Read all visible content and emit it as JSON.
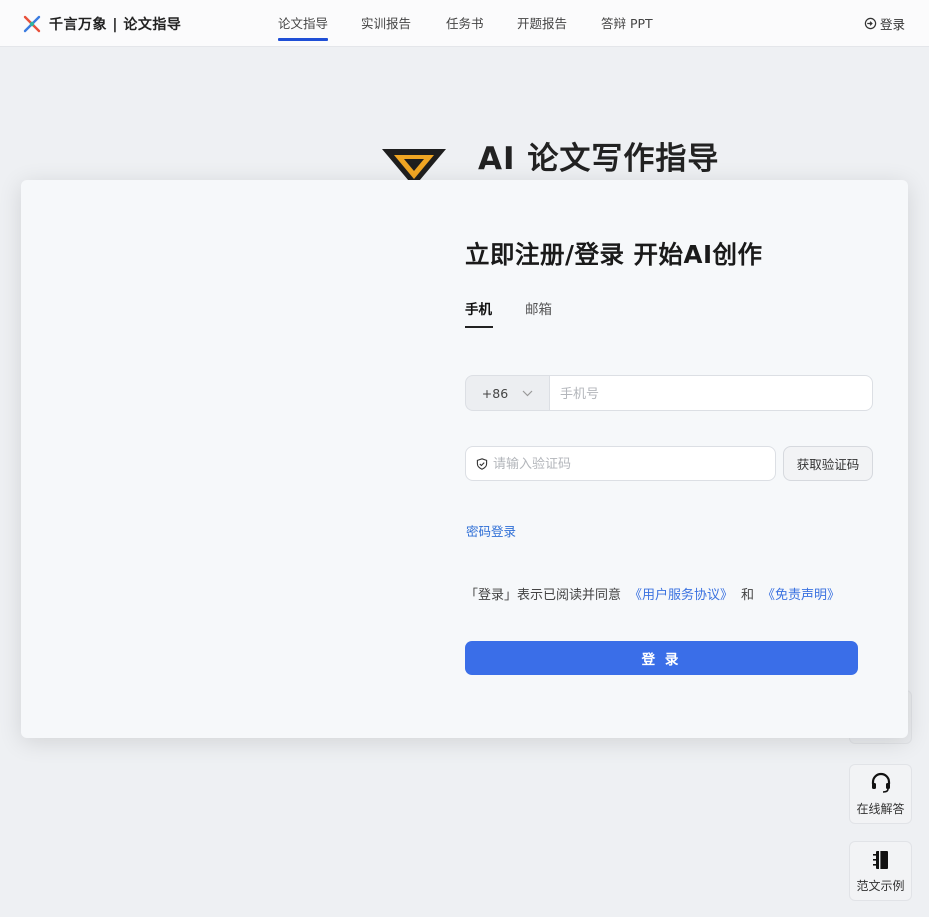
{
  "nav": {
    "brand": "千言万象 | 论文指导",
    "items": [
      "论文指导",
      "实训报告",
      "任务书",
      "开题报告",
      "答辩 PPT"
    ],
    "active_index": 0,
    "login": "登录"
  },
  "hero": {
    "title": "AI 论文写作指导"
  },
  "modal": {
    "title": "立即注册/登录 开始AI创作",
    "tabs": [
      "手机",
      "邮箱"
    ],
    "active_tab": "手机",
    "country_code": "+86",
    "phone_placeholder": "手机号",
    "code_placeholder": "请输入验证码",
    "get_code_label": "获取验证码",
    "password_login_label": "密码登录",
    "agree_prefix": "「登录」表示已阅读并同意",
    "terms_link": "《用户服务协议》",
    "agree_and": "和",
    "disclaimer_link": "《免责声明》",
    "login_button": "登 录"
  },
  "side": {
    "support_label": "在线解答",
    "samples_label": "范文示例"
  },
  "colors": {
    "accent": "#3a6ee8",
    "link": "#2f6fd6",
    "nav_underline": "#1f4fd6"
  }
}
